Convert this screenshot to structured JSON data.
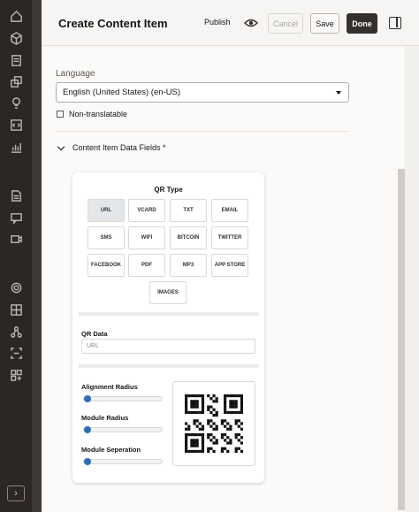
{
  "header": {
    "title": "Create Content Item",
    "publish_label": "Publish",
    "cancel_label": "Cancel",
    "save_label": "Save",
    "done_label": "Done"
  },
  "form": {
    "language_label": "Language",
    "language_value": "English (United States) (en-US)",
    "non_translatable_label": "Non-translatable",
    "fields_section_label": "Content Item Data Fields *"
  },
  "qr": {
    "type_title": "QR Type",
    "types": [
      "URL",
      "VCARD",
      "TXT",
      "EMAIL",
      "SMS",
      "WIFI",
      "BITCOIN",
      "TWITTER",
      "FACEBOOK",
      "PDF",
      "MP3",
      "APP STORE",
      "IMAGES"
    ],
    "selected_type": "URL",
    "data_label": "QR Data",
    "data_placeholder": "URL",
    "sliders": [
      {
        "label": "Alignment Radius",
        "value": 0
      },
      {
        "label": "Module Radius",
        "value": 0
      },
      {
        "label": "Module Seperation",
        "value": 0
      }
    ]
  },
  "rail_icons": [
    "home-icon",
    "cube-icon",
    "documents-icon",
    "assets-icon",
    "lightbulb-icon",
    "code-icon",
    "chart-icon",
    "page-icon",
    "chat-icon",
    "video-icon",
    "settings-icon",
    "layout-icon",
    "network-icon",
    "scan-icon",
    "apps-icon"
  ],
  "colors": {
    "rail": "#2c2624",
    "done_button": "#33302d",
    "slider_knob": "#2f6fb6",
    "selected_type": "#e4e7ea"
  }
}
